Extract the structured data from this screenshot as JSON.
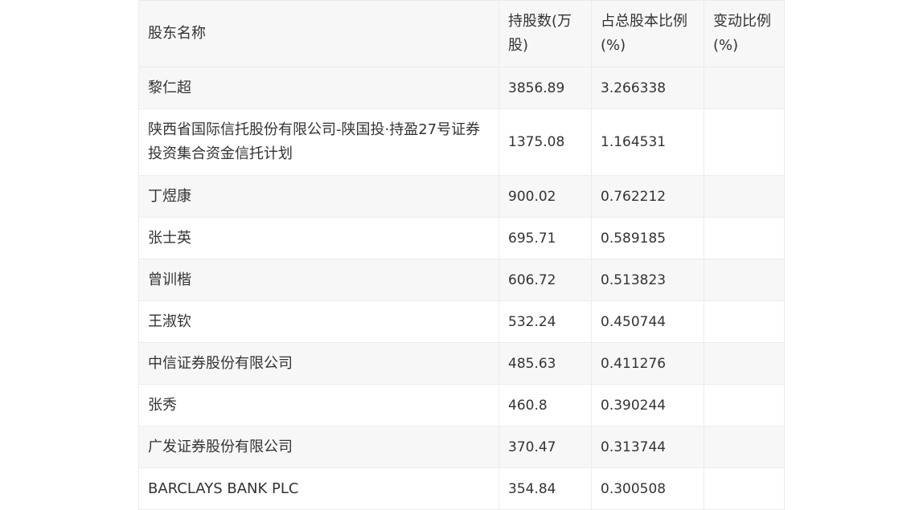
{
  "table": {
    "headers": [
      "股东名称",
      "持股数(万股)",
      "占总股本比例(%)",
      "变动比例(%)"
    ],
    "header_lines": [
      [
        "股东名称"
      ],
      [
        "持股数(万",
        "股)"
      ],
      [
        "占总股本比例",
        "(%)"
      ],
      [
        "变动比例",
        "(%)"
      ]
    ],
    "rows": [
      {
        "name": "黎仁超",
        "shares": "3856.89",
        "ratio": "3.266338",
        "change": ""
      },
      {
        "name": "陕西省国际信托股份有限公司-陕国投·持盈27号证券投资集合资金信托计划",
        "shares": "1375.08",
        "ratio": "1.164531",
        "change": ""
      },
      {
        "name": "丁煜康",
        "shares": "900.02",
        "ratio": "0.762212",
        "change": ""
      },
      {
        "name": "张士英",
        "shares": "695.71",
        "ratio": "0.589185",
        "change": ""
      },
      {
        "name": "曾训楷",
        "shares": "606.72",
        "ratio": "0.513823",
        "change": ""
      },
      {
        "name": "王淑钦",
        "shares": "532.24",
        "ratio": "0.450744",
        "change": ""
      },
      {
        "name": "中信证券股份有限公司",
        "shares": "485.63",
        "ratio": "0.411276",
        "change": ""
      },
      {
        "name": "张秀",
        "shares": "460.8",
        "ratio": "0.390244",
        "change": ""
      },
      {
        "name": "广发证券股份有限公司",
        "shares": "370.47",
        "ratio": "0.313744",
        "change": ""
      },
      {
        "name": "BARCLAYS BANK PLC",
        "shares": "354.84",
        "ratio": "0.300508",
        "change": ""
      }
    ]
  }
}
